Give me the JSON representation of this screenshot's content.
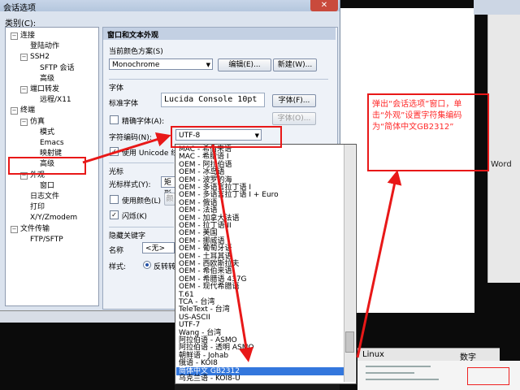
{
  "dialog": {
    "title": "会话选项",
    "close_label": "✕",
    "category_label": "类别(C):"
  },
  "tree": [
    {
      "label": "连接",
      "level": 0,
      "exp": "−"
    },
    {
      "label": "登陆动作",
      "level": 1
    },
    {
      "label": "SSH2",
      "level": 1,
      "exp": "−"
    },
    {
      "label": "SFTP 会话",
      "level": 2
    },
    {
      "label": "高级",
      "level": 2
    },
    {
      "label": "端口转发",
      "level": 1,
      "exp": "−"
    },
    {
      "label": "远程/X11",
      "level": 2
    },
    {
      "label": "终端",
      "level": 0,
      "exp": "−"
    },
    {
      "label": "仿真",
      "level": 1,
      "exp": "−"
    },
    {
      "label": "模式",
      "level": 2
    },
    {
      "label": "Emacs",
      "level": 2
    },
    {
      "label": "映射键",
      "level": 2
    },
    {
      "label": "高级",
      "level": 2
    },
    {
      "label": "外观",
      "level": 1,
      "exp": "−",
      "highlight": true
    },
    {
      "label": "窗口",
      "level": 2
    },
    {
      "label": "日志文件",
      "level": 1
    },
    {
      "label": "打印",
      "level": 1
    },
    {
      "label": "X/Y/Zmodem",
      "level": 1
    },
    {
      "label": "文件传输",
      "level": 0,
      "exp": "−"
    },
    {
      "label": "FTP/SFTP",
      "level": 1
    }
  ],
  "panel": {
    "title": "窗口和文本外观",
    "color_scheme_label": "当前颜色方案(S)",
    "color_scheme_value": "Monochrome",
    "edit_button": "编辑(E)...",
    "new_button": "新建(W)...",
    "font_section": "字体",
    "std_font_label": "标准字体",
    "std_font_value": "Lucida Console 10pt",
    "font_button": "字体(F)...",
    "precise_font_label": "精确字体(A):",
    "font_button2": "字体(O)...",
    "charset_label": "字符编码(N):",
    "charset_value": "UTF-8",
    "unicode_line_label": "使用 Unicode 线条",
    "cursor_section": "光标",
    "cursor_style_label": "光标样式(Y):",
    "cursor_style_value": "矩形",
    "use_color_label": "使用颜色(L)",
    "color_button": "颜",
    "blink_label": "闪烁(K)",
    "hidden_section": "隐藏关键字",
    "name_label": "名称",
    "name_value": "<无>",
    "style_label": "样式:",
    "style_value": "反转转"
  },
  "dropdown": {
    "items": [
      "MAC - 希伯来语",
      "MAC - 希腊语 I",
      "OEM - 阿拉伯语",
      "OEM - 冰岛语",
      "OEM - 波罗的海",
      "OEM - 多语言拉丁语 I",
      "OEM - 多语言拉丁语 I + Euro",
      "OEM - 俄语",
      "OEM - 法语",
      "OEM - 加拿大法语",
      "OEM - 拉丁语 II",
      "OEM - 美国",
      "OEM - 挪威语",
      "OEM - 葡萄牙语",
      "OEM - 土耳其语",
      "OEM - 西欧斯拉夫",
      "OEM - 希伯来语",
      "OEM - 希腊语 437G",
      "OEM - 现代希腊语",
      "T.61",
      "TCA - 台湾",
      "TeleText - 台湾",
      "US-ASCII",
      "UTF-7",
      "Wang - 台湾",
      "阿拉伯语 - ASMO",
      "阿拉伯语 - 透明 ASMO",
      "朝鲜语 - Johab",
      "俄语 - KOI8",
      "简体中文 GB2312",
      "乌克兰语 - KOI8-U"
    ],
    "selected_index": 29
  },
  "annotation": {
    "text": "弹出“会话选项”窗口，单击“外观”设置字符集编码为“简体中文GB2312”"
  },
  "background": {
    "word_label": "Word",
    "linux_label": "Linux",
    "digits_label": "数字"
  },
  "colors": {
    "annotation_red": "#e81818",
    "selection_blue": "#3377dd",
    "dialog_bg": "#dbe3ee"
  }
}
